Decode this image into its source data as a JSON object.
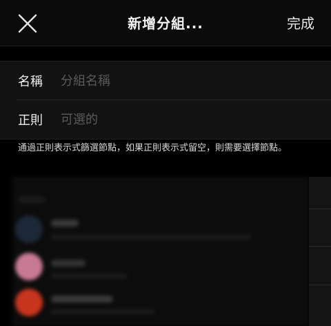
{
  "navbar": {
    "title": "新增分組...",
    "done_label": "完成",
    "close_icon": "close-icon"
  },
  "form": {
    "name_label": "名稱",
    "name_placeholder": "分組名稱",
    "regex_label": "正則",
    "regex_placeholder": "可選的"
  },
  "help_text": "通過正則表示式篩選節點，如果正則表示式留空，則需要選擇節點。",
  "background_list": {
    "avatar_colors": [
      "#1c2838",
      "#c87a94",
      "#c8351f"
    ]
  }
}
